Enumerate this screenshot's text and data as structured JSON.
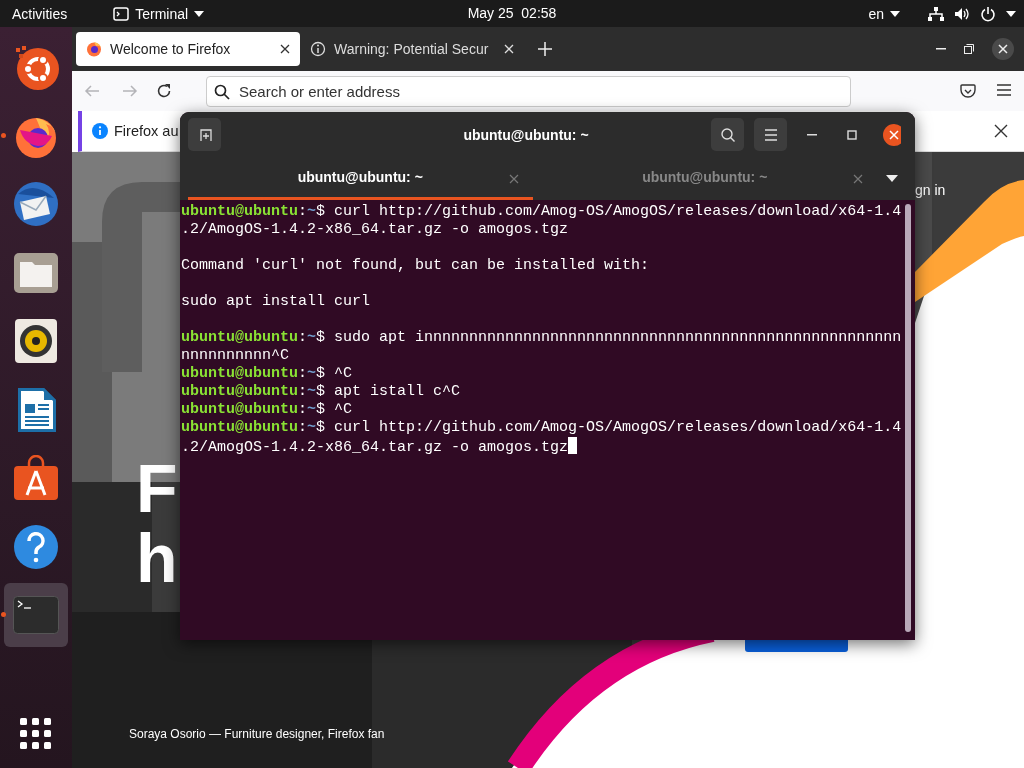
{
  "top_bar": {
    "activities": "Activities",
    "app_menu": {
      "label": "Terminal"
    },
    "clock": "May 25  02:58",
    "keyboard_layout": "en",
    "status_icons": [
      {
        "kind": "network"
      },
      {
        "kind": "volume"
      },
      {
        "kind": "power"
      }
    ]
  },
  "dock": {
    "items": [
      {
        "kind": "ubuntu",
        "running": false,
        "focused": false
      },
      {
        "kind": "firefox",
        "running": true,
        "focused": false
      },
      {
        "kind": "mail",
        "running": false,
        "focused": false
      },
      {
        "kind": "files",
        "running": false,
        "focused": false
      },
      {
        "kind": "music",
        "running": false,
        "focused": false
      },
      {
        "kind": "writer",
        "running": false,
        "focused": false
      },
      {
        "kind": "software",
        "running": false,
        "focused": false
      },
      {
        "kind": "help",
        "running": false,
        "focused": false
      },
      {
        "kind": "terminal",
        "running": true,
        "focused": true
      }
    ]
  },
  "browser": {
    "tabs": [
      {
        "title": "Welcome to Firefox",
        "selected": true
      },
      {
        "title": "Warning: Potential Secur",
        "selected": false
      }
    ],
    "back_button": {
      "disabled": true
    },
    "forward_button": {
      "disabled": true
    },
    "address_bar": {
      "placeholder": "Search or enter address"
    },
    "notification": {
      "text": "Firefox au"
    },
    "page": {
      "headline_lines": [
        "F",
        "h"
      ],
      "sign_in": "gn in",
      "caption": "Soraya Osorio — Furniture designer, Firefox fan"
    }
  },
  "terminal": {
    "title": "ubuntu@ubuntu: ~",
    "tabs": [
      {
        "title": "ubuntu@ubuntu: ~",
        "selected": true
      },
      {
        "title": "ubuntu@ubuntu: ~",
        "selected": false
      }
    ],
    "lines": [
      {
        "kind": "prompt",
        "user": "ubuntu@ubuntu",
        "separator": ":",
        "path": "~",
        "sign": "$",
        "command": "curl http://github.com/Amog-OS/AmogOS/releases/download/x64-1.4"
      },
      {
        "kind": "output",
        "text": ".2/AmogOS-1.4.2-x86_64.tar.gz -o amogos.tgz"
      },
      {
        "kind": "blank"
      },
      {
        "kind": "output",
        "text": "Command 'curl' not found, but can be installed with:"
      },
      {
        "kind": "blank"
      },
      {
        "kind": "output",
        "text": "sudo apt install curl"
      },
      {
        "kind": "blank"
      },
      {
        "kind": "prompt",
        "user": "ubuntu@ubuntu",
        "separator": ":",
        "path": "~",
        "sign": "$",
        "command": "sudo apt innnnnnnnnnnnnnnnnnnnnnnnnnnnnnnnnnnnnnnnnnnnnnnnnnnnn"
      },
      {
        "kind": "output",
        "text": "nnnnnnnnnn^C"
      },
      {
        "kind": "prompt",
        "user": "ubuntu@ubuntu",
        "separator": ":",
        "path": "~",
        "sign": "$",
        "command": "^C"
      },
      {
        "kind": "prompt",
        "user": "ubuntu@ubuntu",
        "separator": ":",
        "path": "~",
        "sign": "$",
        "command": "apt istall c^C"
      },
      {
        "kind": "prompt",
        "user": "ubuntu@ubuntu",
        "separator": ":",
        "path": "~",
        "sign": "$",
        "command": "^C"
      },
      {
        "kind": "prompt",
        "user": "ubuntu@ubuntu",
        "separator": ":",
        "path": "~",
        "sign": "$",
        "command": "curl http://github.com/Amog-OS/AmogOS/releases/download/x64-1.4"
      },
      {
        "kind": "output",
        "text": ".2/AmogOS-1.4.2-x86_64.tar.gz -o amogos.tgz",
        "cursor": true
      }
    ]
  }
}
